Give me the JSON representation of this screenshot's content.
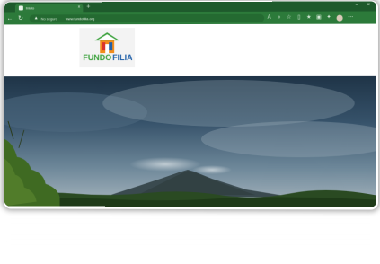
{
  "browser": {
    "tab": {
      "title": "Inicio",
      "favicon": "site-favicon"
    },
    "toolbar": {
      "site_info": "No seguro",
      "url": "www.fundofilia.org",
      "accent_color": "#2c7a3a"
    }
  },
  "site": {
    "logo": {
      "text_left": "FUNDO",
      "text_right": "FILIA",
      "logo_colors": {
        "green": "#3aa13b",
        "blue": "#1f5fa8",
        "orange": "#f28c1b",
        "red": "#d9342b"
      }
    }
  }
}
